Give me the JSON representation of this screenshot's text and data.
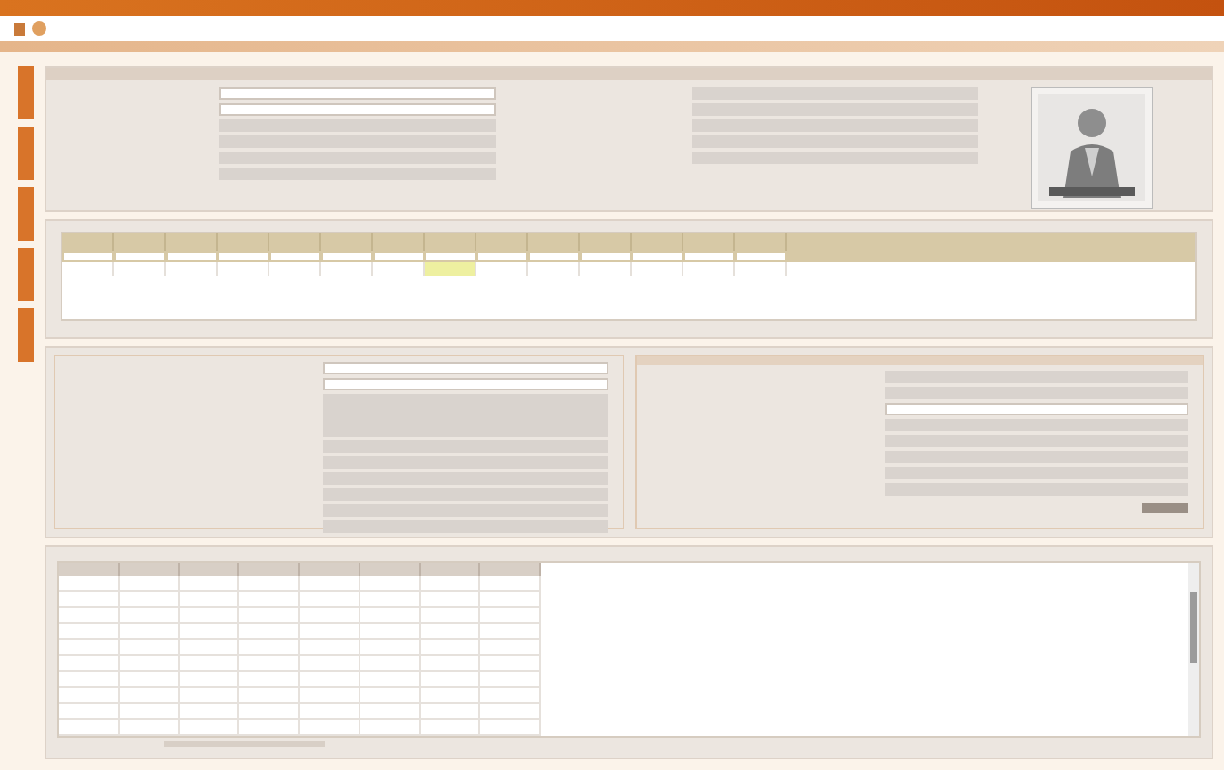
{
  "side_tabs": [
    {
      "kind": "tab"
    },
    {
      "kind": "tab"
    },
    {
      "kind": "tab"
    },
    {
      "kind": "tab"
    },
    {
      "kind": "tab"
    }
  ],
  "profile_left": [
    {
      "kind": "input"
    },
    {
      "kind": "input"
    },
    {
      "kind": "readonly"
    },
    {
      "kind": "readonly"
    },
    {
      "kind": "readonly"
    },
    {
      "kind": "readonly"
    }
  ],
  "profile_right": [
    {
      "kind": "readonly"
    },
    {
      "kind": "readonly"
    },
    {
      "kind": "readonly"
    },
    {
      "kind": "readonly"
    },
    {
      "kind": "readonly"
    }
  ],
  "grid_columns": [
    {
      "highlighted": false
    },
    {
      "highlighted": false
    },
    {
      "highlighted": false
    },
    {
      "highlighted": false
    },
    {
      "highlighted": false
    },
    {
      "highlighted": false
    },
    {
      "highlighted": false
    },
    {
      "highlighted": true
    },
    {
      "highlighted": false
    },
    {
      "highlighted": false
    },
    {
      "highlighted": false
    },
    {
      "highlighted": false
    },
    {
      "highlighted": false
    },
    {
      "highlighted": false
    }
  ],
  "left_panel": [
    {
      "kind": "input"
    },
    {
      "kind": "input"
    },
    {
      "kind": "area"
    },
    {
      "kind": "readonly"
    },
    {
      "kind": "readonly"
    },
    {
      "kind": "readonly"
    },
    {
      "kind": "readonly"
    },
    {
      "kind": "readonly"
    },
    {
      "kind": "readonly"
    }
  ],
  "right_panel": [
    {
      "kind": "readonly"
    },
    {
      "kind": "readonly"
    },
    {
      "kind": "input"
    },
    {
      "kind": "readonly"
    },
    {
      "kind": "readonly"
    },
    {
      "kind": "readonly"
    },
    {
      "kind": "readonly"
    },
    {
      "kind": "readonly"
    }
  ],
  "bottom_table": {
    "columns": [
      {
        "kind": "col"
      },
      {
        "kind": "col"
      },
      {
        "kind": "col"
      },
      {
        "kind": "col"
      },
      {
        "kind": "col"
      },
      {
        "kind": "col"
      },
      {
        "kind": "col"
      },
      {
        "kind": "col"
      }
    ],
    "rows": [
      {
        "selected": false
      },
      {
        "selected": false
      },
      {
        "selected": false
      },
      {
        "selected": false
      },
      {
        "selected": false
      },
      {
        "selected": false
      },
      {
        "selected": false
      },
      {
        "selected": false
      },
      {
        "selected": false
      },
      {
        "selected": false
      }
    ]
  }
}
